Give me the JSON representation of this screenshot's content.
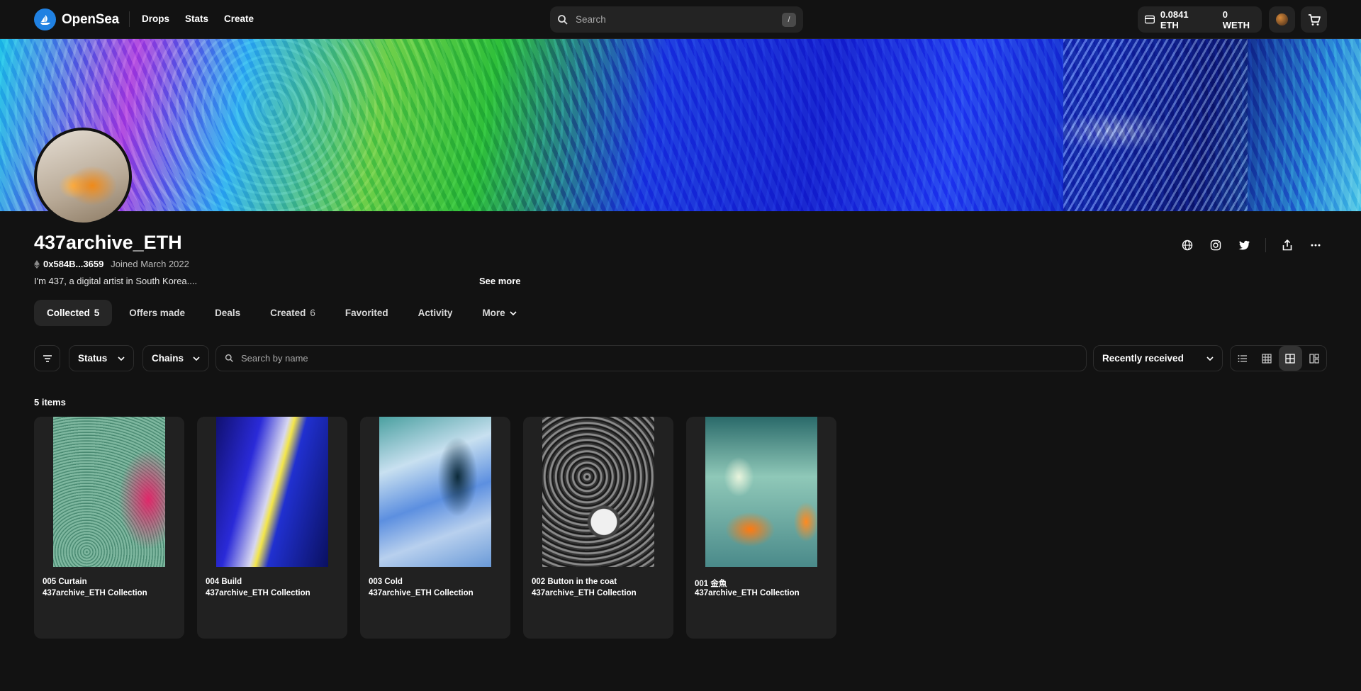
{
  "header": {
    "logo_text": "OpenSea",
    "nav": [
      "Drops",
      "Stats",
      "Create"
    ],
    "search_placeholder": "Search",
    "search_shortcut": "/",
    "wallet": {
      "eth": "0.0841 ETH",
      "weth": "0 WETH"
    }
  },
  "profile": {
    "username": "437archive_ETH",
    "address": "0x584B...3659",
    "joined": "Joined March 2022",
    "bio": "I'm 437, a digital artist in South Korea....",
    "see_more": "See more"
  },
  "tabs": [
    {
      "label": "Collected",
      "count": "5",
      "active": true
    },
    {
      "label": "Offers made",
      "count": ""
    },
    {
      "label": "Deals",
      "count": ""
    },
    {
      "label": "Created",
      "count": "6"
    },
    {
      "label": "Favorited",
      "count": ""
    },
    {
      "label": "Activity",
      "count": ""
    },
    {
      "label": "More",
      "count": ""
    }
  ],
  "filters": {
    "status": "Status",
    "chains": "Chains",
    "search_placeholder": "Search by name",
    "sort": "Recently received"
  },
  "items_count": "5 items",
  "items": [
    {
      "title": "005 Curtain",
      "collection": "437archive_ETH Collection"
    },
    {
      "title": "004 Build",
      "collection": "437archive_ETH Collection"
    },
    {
      "title": "003 Cold",
      "collection": "437archive_ETH Collection"
    },
    {
      "title": "002 Button in the coat",
      "collection": "437archive_ETH Collection"
    },
    {
      "title": "001 金魚",
      "collection": "437archive_ETH Collection"
    }
  ],
  "colors": {
    "background": "#121212",
    "surface": "#212121",
    "accent": "#2081e2"
  }
}
